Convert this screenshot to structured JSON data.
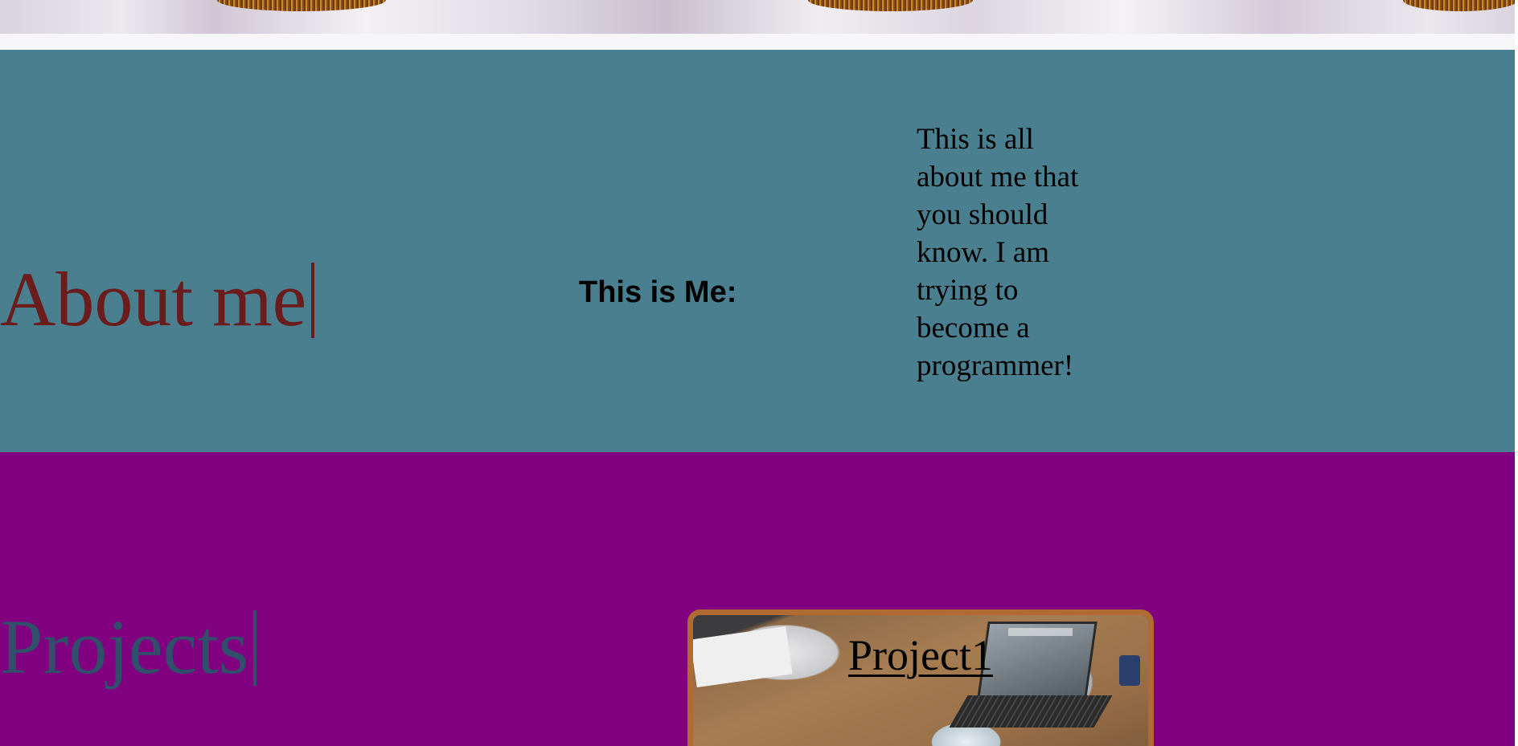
{
  "about": {
    "heading": "About me",
    "subheading": "This is Me:",
    "text": "This is all about me that you should know. I am trying to become a programmer!"
  },
  "projects": {
    "heading": "Projects",
    "cards": [
      {
        "title": "Project1"
      }
    ]
  },
  "colors": {
    "about_background": "#4a7f8f",
    "about_heading": "#6b1d1d",
    "projects_background": "#800080",
    "projects_heading": "#2f4f6b",
    "card_border": "#b06a33"
  }
}
